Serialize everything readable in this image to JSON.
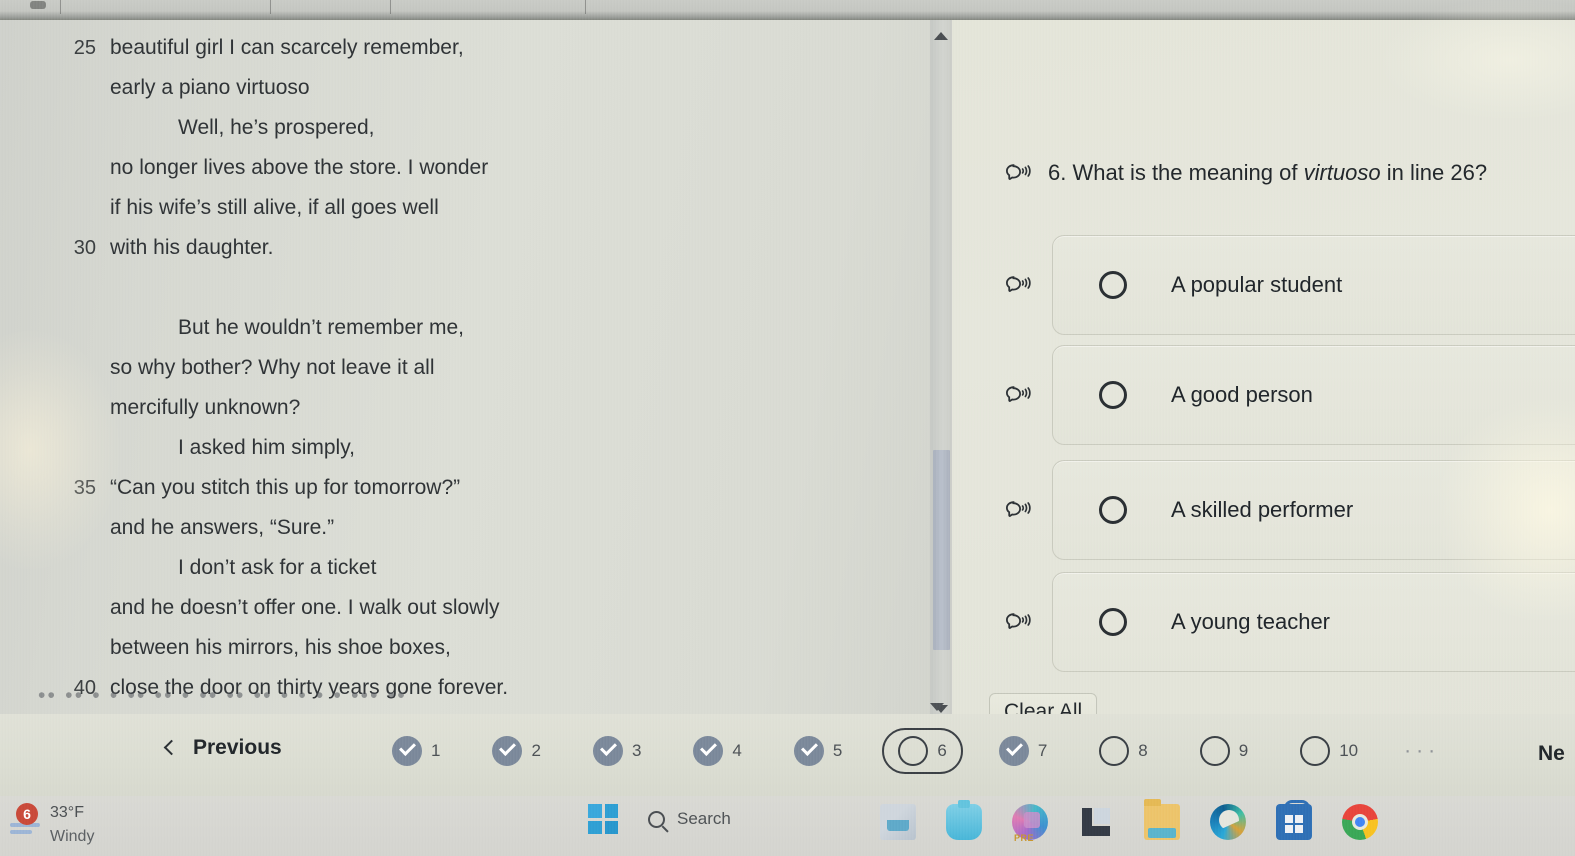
{
  "poem": {
    "lines": [
      {
        "num": "25",
        "text": "beautiful girl I can scarcely remember,",
        "indent": 0
      },
      {
        "num": "",
        "text": "early a piano virtuoso",
        "indent": 0
      },
      {
        "num": "",
        "text": "Well, he’s prospered,",
        "indent": 1
      },
      {
        "num": "",
        "text": "no longer lives above the store. I wonder",
        "indent": 0
      },
      {
        "num": "",
        "text": "if his wife’s still alive, if all goes well",
        "indent": 0
      },
      {
        "num": "30",
        "text": "with his daughter.",
        "indent": 0
      },
      {
        "num": "",
        "text": "",
        "indent": 0
      },
      {
        "num": "",
        "text": "But he wouldn’t remember me,",
        "indent": 1
      },
      {
        "num": "",
        "text": "so why bother? Why not leave it all",
        "indent": 0
      },
      {
        "num": "",
        "text": "mercifully unknown?",
        "indent": 0
      },
      {
        "num": "",
        "text": "I asked him simply,",
        "indent": 1
      },
      {
        "num": "35",
        "text": "“Can you stitch this up for tomorrow?”",
        "indent": 0
      },
      {
        "num": "",
        "text": "and he answers, “Sure.”",
        "indent": 0
      },
      {
        "num": "",
        "text": "I don’t ask for a ticket",
        "indent": 1
      },
      {
        "num": "",
        "text": "and he doesn’t offer one. I walk out slowly",
        "indent": 0
      },
      {
        "num": "",
        "text": "between his mirrors, his shoe boxes,",
        "indent": 0
      },
      {
        "num": "40",
        "text": "close the door on thirty years gone forever.",
        "indent": 0
      }
    ],
    "cut_off_line": "•• •• • • •• •• • ••  ••   •• • •   • •  •••  ••"
  },
  "question": {
    "number": "6.",
    "prompt_before": "What is the meaning of",
    "prompt_italic": "virtuoso",
    "prompt_after": "in line 26?",
    "speaker_icon": "read-aloud-icon",
    "options": [
      {
        "label": "A popular student",
        "selected": false
      },
      {
        "label": "A good person",
        "selected": false
      },
      {
        "label": "A skilled performer",
        "selected": false
      },
      {
        "label": "A young teacher",
        "selected": false
      }
    ],
    "clear_all_label": "Clear All"
  },
  "nav": {
    "previous_label": "Previous",
    "next_label": "Ne",
    "ellipsis": "···",
    "items": [
      {
        "num": "1",
        "state": "done"
      },
      {
        "num": "2",
        "state": "done"
      },
      {
        "num": "3",
        "state": "done"
      },
      {
        "num": "4",
        "state": "done"
      },
      {
        "num": "5",
        "state": "done"
      },
      {
        "num": "6",
        "state": "current"
      },
      {
        "num": "7",
        "state": "done"
      },
      {
        "num": "8",
        "state": "empty"
      },
      {
        "num": "9",
        "state": "empty"
      },
      {
        "num": "10",
        "state": "empty"
      }
    ]
  },
  "taskbar": {
    "weather": {
      "temperature": "33°F",
      "condition": "Windy",
      "badge_count": "6"
    },
    "start_icon": "windows-start-icon",
    "search_label": "Search",
    "apps": [
      {
        "name": "paint-icon"
      },
      {
        "name": "water-drop-icon"
      },
      {
        "name": "copilot-icon",
        "tag": "PRE"
      },
      {
        "name": "lshape-app-icon"
      },
      {
        "name": "file-explorer-icon"
      },
      {
        "name": "microsoft-edge-icon"
      },
      {
        "name": "microsoft-store-icon"
      },
      {
        "name": "google-chrome-icon"
      }
    ]
  },
  "colors": {
    "page_bg": "#dddfd6",
    "question_bg": "#e4e5d9",
    "poem_bg": "#d6d8d1",
    "text": "#22272b",
    "done_marker": "#7b889a",
    "badge_red": "#c94a3a",
    "accent_blue": "#2a9fd6"
  }
}
